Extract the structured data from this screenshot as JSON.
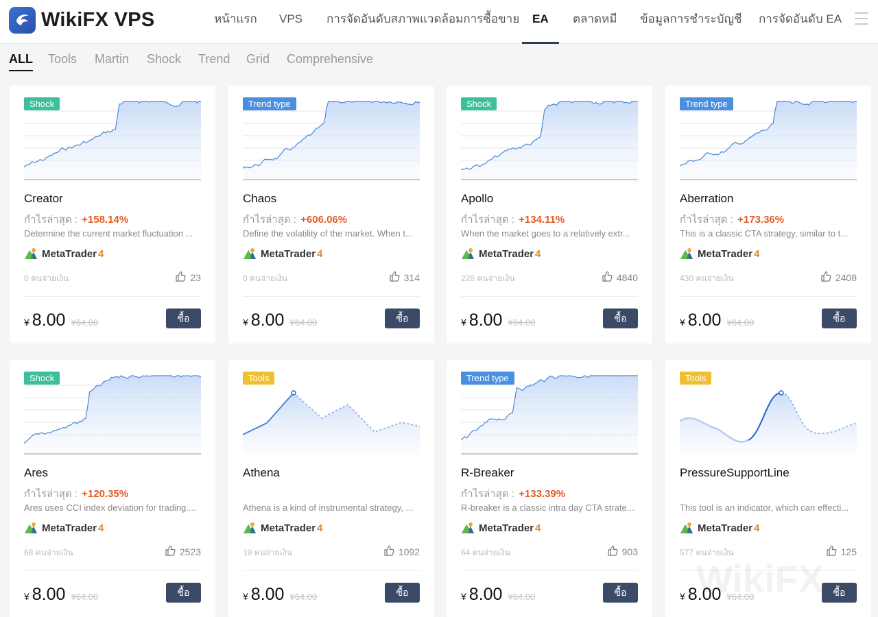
{
  "header": {
    "logo_text": "WikiFX VPS",
    "nav": [
      {
        "label": "หน้าแรก",
        "active": false
      },
      {
        "label": "VPS",
        "active": false
      },
      {
        "label": "การจัดอันดับสภาพแวดล้อมการซื้อขาย",
        "active": false
      },
      {
        "label": "EA",
        "active": true
      },
      {
        "label": "ตลาดหมี",
        "active": false
      },
      {
        "label": "ข้อมูลการชำระบัญชี",
        "active": false
      },
      {
        "label": "การจัดอันดับ EA",
        "active": false
      }
    ],
    "menu_icon": "hamburger-icon"
  },
  "filters": [
    {
      "label": "ALL",
      "active": true
    },
    {
      "label": "Tools",
      "active": false
    },
    {
      "label": "Martin",
      "active": false
    },
    {
      "label": "Shock",
      "active": false
    },
    {
      "label": "Trend",
      "active": false
    },
    {
      "label": "Grid",
      "active": false
    },
    {
      "label": "Comprehensive",
      "active": false
    }
  ],
  "platform": {
    "name": "MetaTrader",
    "version": "4"
  },
  "common": {
    "profit_label": "กำไรล่าสุด :",
    "currency": "¥",
    "price": "8.00",
    "old_price": "¥64.00",
    "buy_label": "ซื้อ",
    "paid_suffix": "คนจ่ายเงิน"
  },
  "colors": {
    "accent": "#3b4a66",
    "profit": "#e35b21",
    "shock": "#3dbf9c",
    "trend": "#4a90e2",
    "tools": "#f0c030",
    "chart_line": "#4a86d8"
  },
  "cards": [
    {
      "name": "Creator",
      "badge": "Shock",
      "badge_type": "shock",
      "profit": "+158.14%",
      "desc": "Determine the current market fluctuation ...",
      "buyers": "0 คนจ่ายเงิน",
      "likes": "23",
      "chart": "shock"
    },
    {
      "name": "Chaos",
      "badge": "Trend type",
      "badge_type": "trend",
      "profit": "+606.06%",
      "desc": "Define the volatility of the market. When t...",
      "buyers": "0 คนจ่ายเงิน",
      "likes": "314",
      "chart": "trend"
    },
    {
      "name": "Apollo",
      "badge": "Shock",
      "badge_type": "shock",
      "profit": "+134.11%",
      "desc": "When the market goes to a relatively extr...",
      "buyers": "226 คนจ่ายเงิน",
      "likes": "4840",
      "chart": "shock"
    },
    {
      "name": "Aberration",
      "badge": "Trend type",
      "badge_type": "trend",
      "profit": "+173.36%",
      "desc": "This is a classic CTA strategy, similar to t...",
      "buyers": "430 คนจ่ายเงิน",
      "likes": "2408",
      "chart": "trend"
    },
    {
      "name": "Ares",
      "badge": "Shock",
      "badge_type": "shock",
      "profit": "+120.35%",
      "desc": "Ares uses CCI index deviation for trading....",
      "buyers": "68 คนจ่ายเงิน",
      "likes": "2523",
      "chart": "shock"
    },
    {
      "name": "Athena",
      "badge": "Tools",
      "badge_type": "tools",
      "profit": "",
      "desc": "Athena is a kind of instrumental strategy, ...",
      "buyers": "19 คนจ่ายเงิน",
      "likes": "1092",
      "chart": "tools-zigzag"
    },
    {
      "name": "R-Breaker",
      "badge": "Trend type",
      "badge_type": "trend",
      "profit": "+133.39%",
      "desc": "R-breaker is a classic intra day CTA strate...",
      "buyers": "64 คนจ่ายเงิน",
      "likes": "903",
      "chart": "trend"
    },
    {
      "name": "PressureSupportLine",
      "badge": "Tools",
      "badge_type": "tools",
      "profit": "",
      "desc": "This tool is an indicator, which can effecti...",
      "buyers": "577 คนจ่ายเงิน",
      "likes": "125",
      "chart": "tools-wave"
    }
  ],
  "watermark": "WikiFX"
}
